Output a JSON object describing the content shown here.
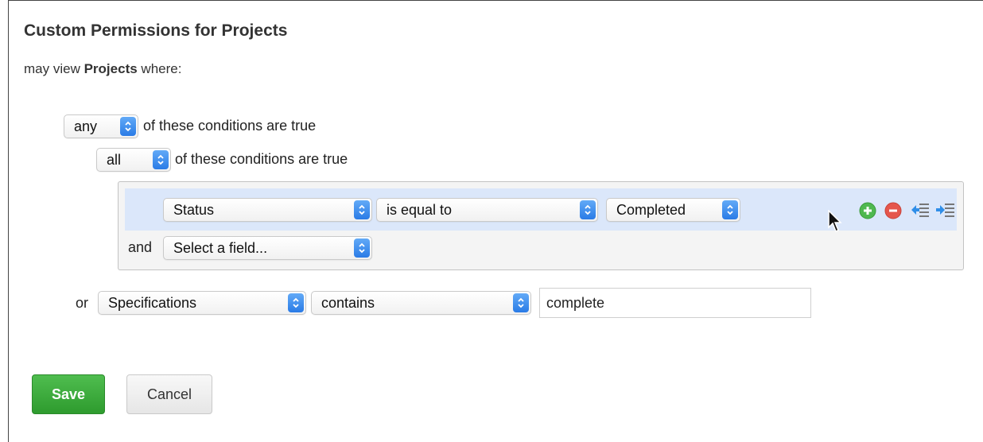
{
  "header": {
    "title": "Custom Permissions for Projects",
    "intro_prefix": "may view",
    "intro_bold": "Projects",
    "intro_suffix": "where:"
  },
  "outer_group": {
    "quantifier": "any",
    "suffix": "of these conditions are true"
  },
  "inner_group": {
    "quantifier": "all",
    "suffix": "of these conditions are true",
    "condition": {
      "field": "Status",
      "operator": "is equal to",
      "value": "Completed"
    },
    "add_row": {
      "conjunction": "and",
      "field_placeholder": "Select a field..."
    },
    "row_actions": [
      "add-condition-icon",
      "remove-condition-icon",
      "outdent-icon",
      "indent-icon"
    ]
  },
  "or_condition": {
    "conjunction": "or",
    "field": "Specifications",
    "operator": "contains",
    "value": "complete"
  },
  "actions": {
    "save_label": "Save",
    "cancel_label": "Cancel"
  },
  "colors": {
    "save": "#3aa83a",
    "highlight_row": "#dbe7fa",
    "select_arrow": "#3b8cef"
  }
}
